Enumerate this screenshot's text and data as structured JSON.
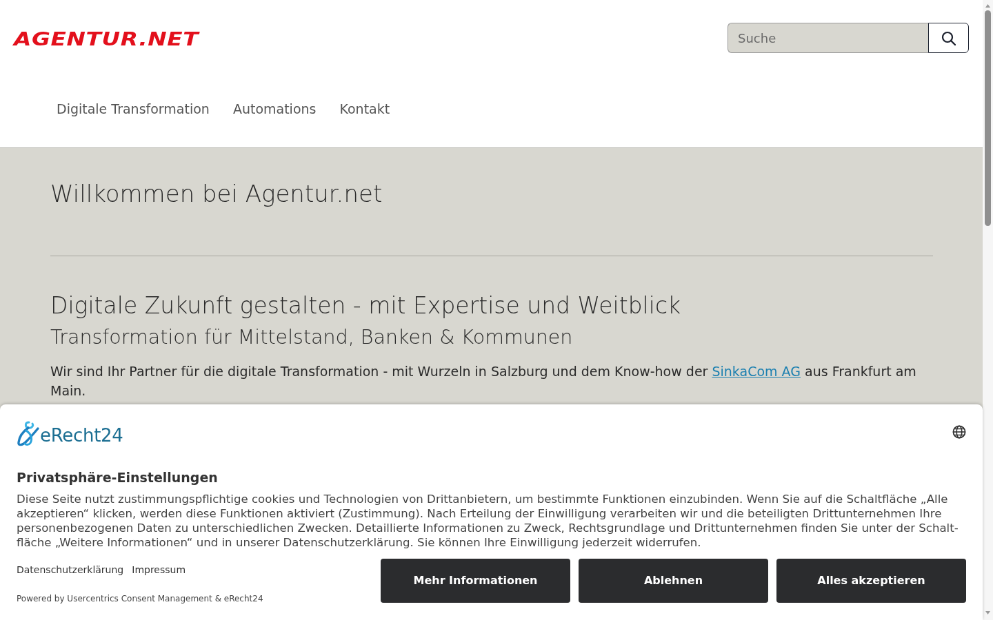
{
  "header": {
    "logo": "AGENTUR.NET",
    "search": {
      "placeholder": "Suche"
    },
    "nav": [
      "Digitale Transformation",
      "Automations",
      "Kontakt"
    ]
  },
  "main": {
    "welcome": "Willkommen bei Agentur.net",
    "heading": "Digitale Zukunft gestalten - mit Expertise und Weitblick",
    "subheading": "Transformation für Mittelstand, Banken & Kommunen",
    "intro": {
      "before": "Wir sind Ihr Partner für die digitale Transformation - mit Wurzeln in Salzburg und dem Know-how der ",
      "link": "SinkaCom AG",
      "after": " aus Frankfurt am Main."
    }
  },
  "consent_banner": {
    "brand": "eRecht24",
    "title": "Privatsphäre-Einstellungen",
    "text": "Diese Seite nutzt zustimmungspflichtige cookies und Technologien von Drittanbietern, um bestimmte Funktionen einzubinden. Wenn Sie auf die Schaltfläche „Alle akzeptieren“ klicken, werden diese Funktionen aktiviert (Zustimmung). Nach Erteilung der Einwilligung verarbeiten wir und die beteiligten Drittunternehmen Ihre personenbezogenen Daten zu unterschiedlichen Zwecken. Detaillierte Informationen zu Zweck, Rechtsgrundlage und Drittunternehmen finden Sie unter der Schalt-fläche „Weitere Informationen“ und in unserer Datenschutzerklärung. Sie können Ihre Einwilligung jederzeit widerrufen.",
    "links": [
      "Datenschutzerklärung",
      "Impressum"
    ],
    "powered_by": "Powered by Usercentrics Consent Management & eRecht24",
    "buttons": [
      "Mehr Informationen",
      "Ablehnen",
      "Alles akzeptieren"
    ]
  }
}
